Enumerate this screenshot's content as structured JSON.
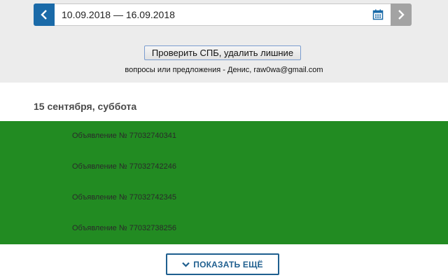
{
  "date_range": {
    "value": "10.09.2018 — 16.09.2018"
  },
  "actions": {
    "check_label": "Проверить СПБ, удалить лишние"
  },
  "contact": {
    "text": "вопросы или предложения - Денис, raw0wa@gmail.com"
  },
  "day": {
    "heading": "15 сентября, суббота"
  },
  "ads": [
    "Объявление № 77032740341",
    "Объявление № 77032742246",
    "Объявление № 77032742345",
    "Объявление № 77032738256"
  ],
  "show_more": {
    "label": "ПОКАЗАТЬ ЕЩЁ"
  },
  "colors": {
    "accent": "#1a6aa8",
    "ads_background": "#228b22",
    "panel_background": "#ececec"
  },
  "icons": {
    "prev": "chevron-left-icon",
    "next": "chevron-right-icon",
    "calendar": "calendar-icon",
    "more": "chevron-down-icon"
  }
}
